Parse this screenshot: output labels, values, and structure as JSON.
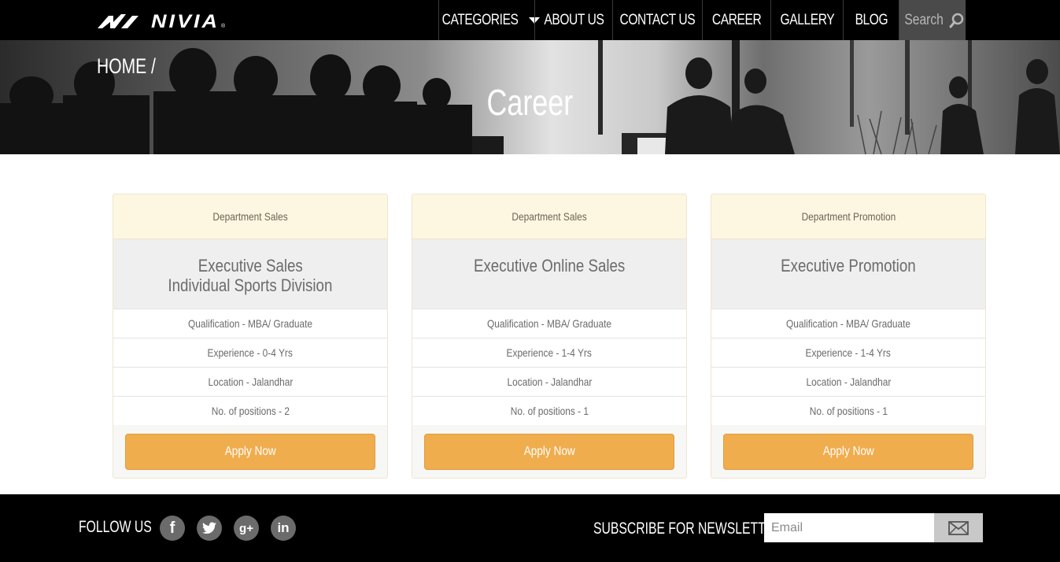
{
  "header": {
    "logo_text": "NIVIA",
    "logo_mark": "®",
    "nav": {
      "categories": "CATEGORIES",
      "about": "ABOUT US",
      "contact": "CONTACT US",
      "career": "CAREER",
      "gallery": "GALLERY",
      "blog": "BLOG"
    },
    "search_label": "Search",
    "search_icon": "search-icon"
  },
  "hero": {
    "breadcrumb": "HOME /",
    "title": "Career"
  },
  "cards": [
    {
      "department": "Department Sales",
      "title_line1": "Executive Sales",
      "title_line2": "Individual Sports Division",
      "qualification": "Qualification - MBA/ Graduate",
      "experience": "Experience - 0-4 Yrs",
      "location": "Location - Jalandhar",
      "positions": "No. of positions - 2",
      "apply": "Apply Now"
    },
    {
      "department": "Department Sales",
      "title_line1": "Executive Online Sales",
      "title_line2": "",
      "qualification": "Qualification - MBA/ Graduate",
      "experience": "Experience - 1-4 Yrs",
      "location": "Location - Jalandhar",
      "positions": "No. of positions - 1",
      "apply": "Apply Now"
    },
    {
      "department": "Department Promotion",
      "title_line1": "Executive Promotion",
      "title_line2": "",
      "qualification": "Qualification - MBA/ Graduate",
      "experience": "Experience - 1-4 Yrs",
      "location": "Location - Jalandhar",
      "positions": "No. of positions - 1",
      "apply": "Apply Now"
    }
  ],
  "footer": {
    "follow_us": "FOLLOW US",
    "social": {
      "facebook": "f",
      "twitter": "twitter-icon",
      "googleplus": "g+",
      "linkedin": "in"
    },
    "subscribe": "SUBSCRIBE FOR NEWSLETTER",
    "email_placeholder": "Email",
    "email_button_icon": "envelope-icon"
  },
  "colors": {
    "accent": "#f0ad4e",
    "card_head": "#fdf6e1",
    "header_bg": "#000000"
  }
}
